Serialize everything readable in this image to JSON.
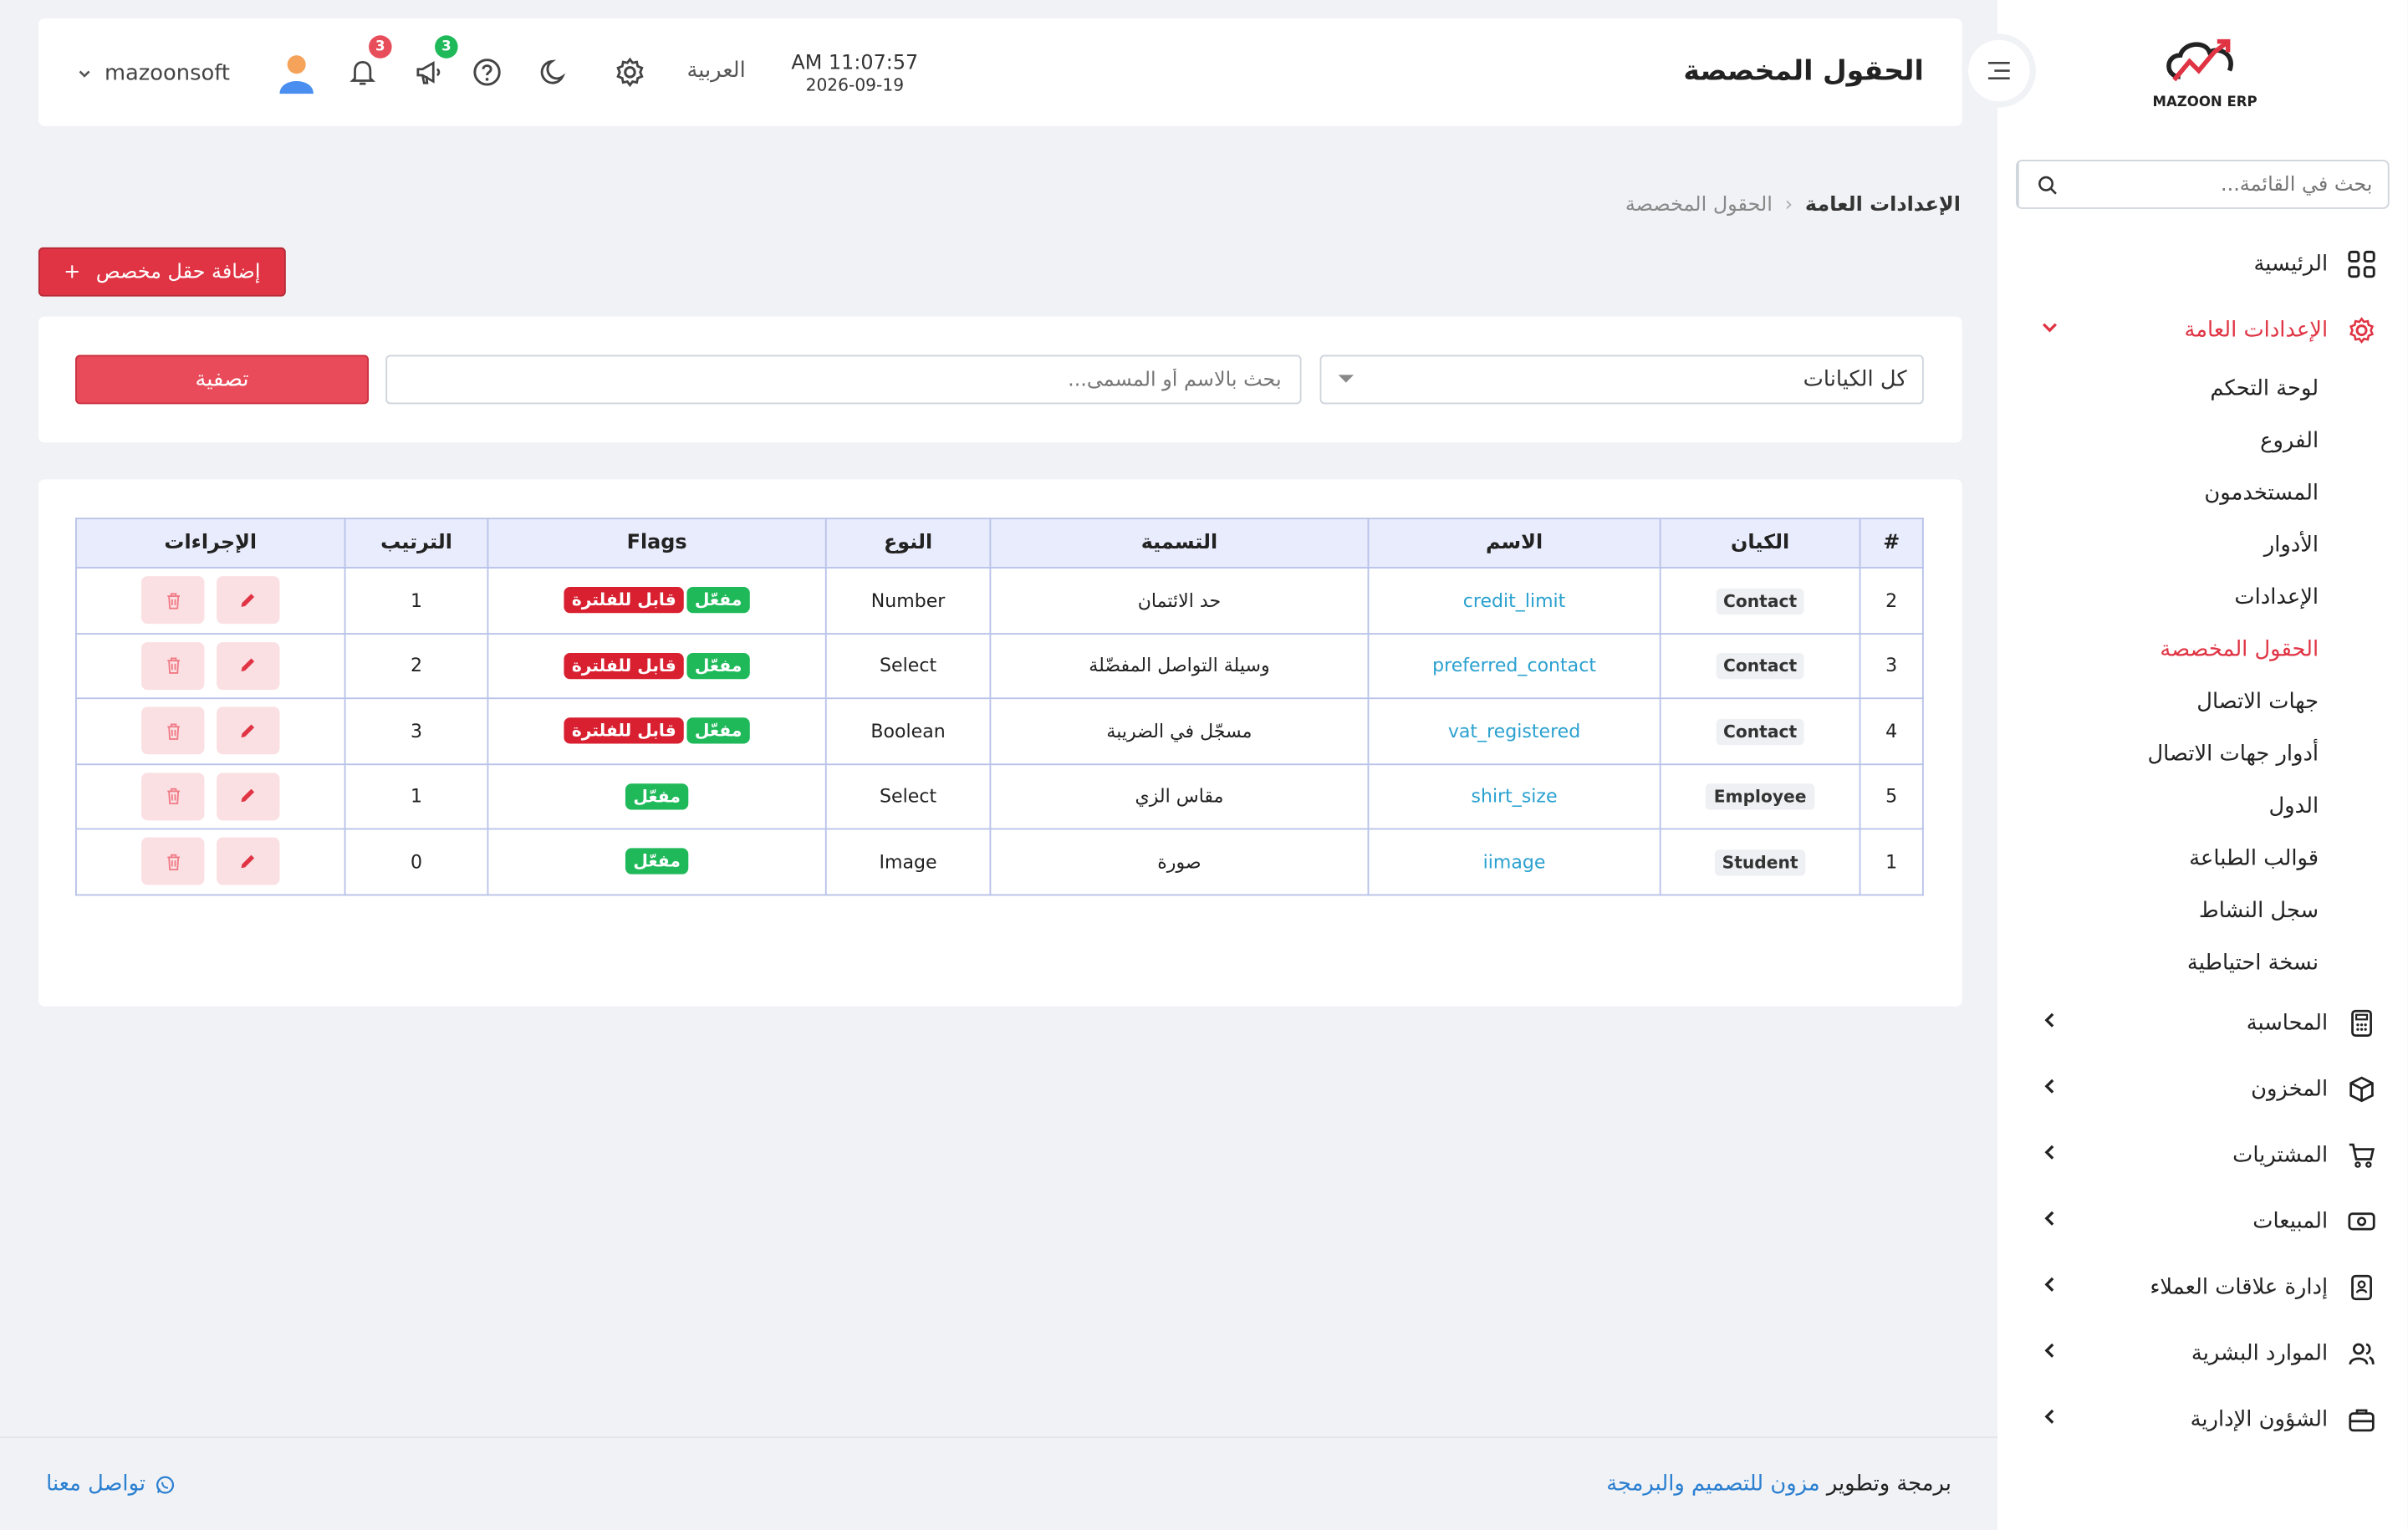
{
  "header": {
    "title": "الحقول المخصصة",
    "time": "AM 11:07:57",
    "date": "2026-09-19",
    "language": "العربية",
    "notif_count": "3",
    "announce_count": "3",
    "username": "mazoonsoft",
    "colors": {
      "accent": "#e03444",
      "notif_badge": "#e84d5b",
      "announce_badge": "#1fb95a"
    }
  },
  "sidebar": {
    "brand": "MAZOON ERP",
    "search_placeholder": "بحث في القائمة...",
    "home": "الرئيسية",
    "general_settings": "الإعدادات العامة",
    "sub_items": [
      "لوحة التحكم",
      "الفروع",
      "المستخدمون",
      "الأدوار",
      "الإعدادات",
      "الحقول المخصصة",
      "جهات الاتصال",
      "أدوار جهات الاتصال",
      "الدول",
      "قوالب الطباعة",
      "سجل النشاط",
      "نسخة احتياطية"
    ],
    "sections": [
      "المحاسبة",
      "المخزون",
      "المشتريات",
      "المبيعات",
      "إدارة علاقات العملاء",
      "الموارد البشرية",
      "الشؤون الإدارية"
    ]
  },
  "breadcrumb": {
    "parent": "الإعدادات العامة",
    "current": "الحقول المخصصة"
  },
  "toolbar": {
    "add_label": "إضافة حقل مخصص"
  },
  "filter": {
    "entity_value": "كل الكيانات",
    "search_placeholder": "بحث بالاسم أو المسمى...",
    "button_label": "تصفية"
  },
  "table": {
    "headers": [
      "#",
      "الكيان",
      "الاسم",
      "التسمية",
      "النوع",
      "Flags",
      "الترتيب",
      "الإجراءات"
    ],
    "flag_enabled": "مفعّل",
    "flag_filterable": "قابل للفلترة",
    "rows": [
      {
        "id": "2",
        "entity": "Contact",
        "name": "credit_limit",
        "label": "حد الائتمان",
        "type": "Number",
        "order": "1"
      },
      {
        "id": "3",
        "entity": "Contact",
        "name": "preferred_contact",
        "label": "وسيلة التواصل المفضّلة",
        "type": "Select",
        "order": "2"
      },
      {
        "id": "4",
        "entity": "Contact",
        "name": "vat_registered",
        "label": "مسجّل في الضريبة",
        "type": "Boolean",
        "order": "3"
      },
      {
        "id": "5",
        "entity": "Employee",
        "name": "shirt_size",
        "label": "مقاس الزي",
        "type": "Select",
        "order": "1"
      },
      {
        "id": "1",
        "entity": "Student",
        "name": "iimage",
        "label": "صورة",
        "type": "Image",
        "order": "0"
      }
    ]
  },
  "footer": {
    "credits_prefix": "برمجة وتطوير",
    "company": "مزون للتصميم والبرمجة",
    "contact": "تواصل معنا"
  }
}
